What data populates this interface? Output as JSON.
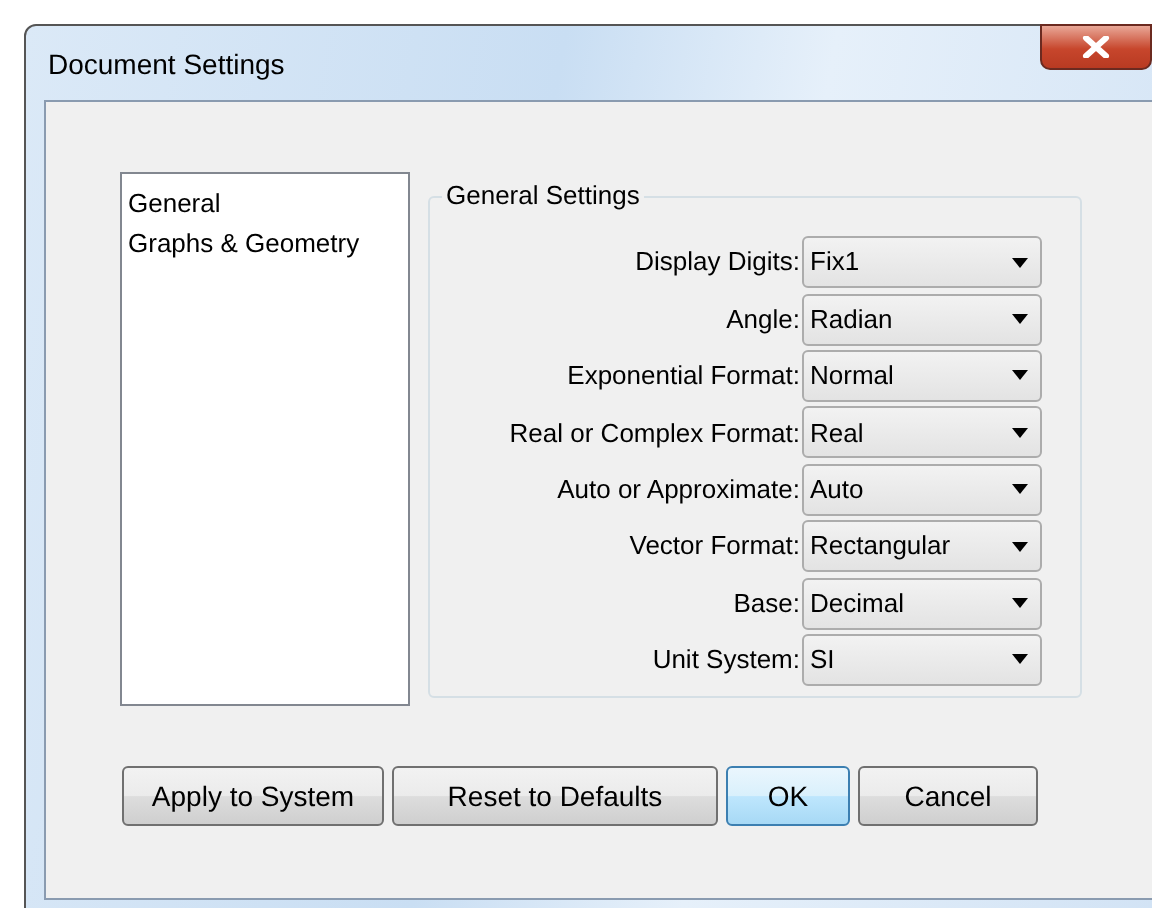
{
  "window": {
    "title": "Document Settings"
  },
  "sidebar": {
    "items": [
      {
        "label": "General"
      },
      {
        "label": "Graphs & Geometry"
      }
    ]
  },
  "group": {
    "title": "General Settings",
    "settings": [
      {
        "label": "Display Digits:",
        "value": "Fix1"
      },
      {
        "label": "Angle:",
        "value": "Radian"
      },
      {
        "label": "Exponential Format:",
        "value": "Normal"
      },
      {
        "label": "Real or Complex Format:",
        "value": "Real"
      },
      {
        "label": "Auto or Approximate:",
        "value": "Auto"
      },
      {
        "label": "Vector Format:",
        "value": "Rectangular"
      },
      {
        "label": "Base:",
        "value": "Decimal"
      },
      {
        "label": "Unit System:",
        "value": "SI"
      }
    ]
  },
  "buttons": [
    {
      "label": "Apply to System",
      "default": false
    },
    {
      "label": "Reset to Defaults",
      "default": false
    },
    {
      "label": "OK",
      "default": true
    },
    {
      "label": "Cancel",
      "default": false
    }
  ]
}
